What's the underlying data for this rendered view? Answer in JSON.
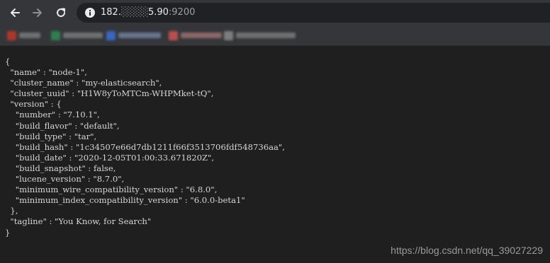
{
  "browser": {
    "url": {
      "host_start": "182.",
      "masked": "░░░░",
      "host_end": "5.90",
      "port": ":9200"
    },
    "icons": {
      "back": "back-arrow-icon",
      "forward": "forward-arrow-icon",
      "reload": "reload-icon",
      "site_info": "info-icon"
    },
    "bookmarks_bar": {
      "blurred": true,
      "colors": [
        "#c0392b",
        "#2e8b57",
        "#3b6fd8",
        "#d35454",
        "#8a8a8a"
      ]
    }
  },
  "page": {
    "json_text": "{\n  \"name\" : \"node-1\",\n  \"cluster_name\" : \"my-elasticsearch\",\n  \"cluster_uuid\" : \"H1W8yToMTCm-WHPMket-tQ\",\n  \"version\" : {\n    \"number\" : \"7.10.1\",\n    \"build_flavor\" : \"default\",\n    \"build_type\" : \"tar\",\n    \"build_hash\" : \"1c34507e66d7db1211f66f3513706fdf548736aa\",\n    \"build_date\" : \"2020-12-05T01:00:33.671820Z\",\n    \"build_snapshot\" : false,\n    \"lucene_version\" : \"8.7.0\",\n    \"minimum_wire_compatibility_version\" : \"6.8.0\",\n    \"minimum_index_compatibility_version\" : \"6.0.0-beta1\"\n  },\n  \"tagline\" : \"You Know, for Search\"\n}",
    "watermark": "https://blog.csdn.net/qq_39027229"
  },
  "theme": {
    "toolbar_bg": "#35363a",
    "page_bg": "#1f1f1f",
    "text": "#d6d6d6"
  }
}
